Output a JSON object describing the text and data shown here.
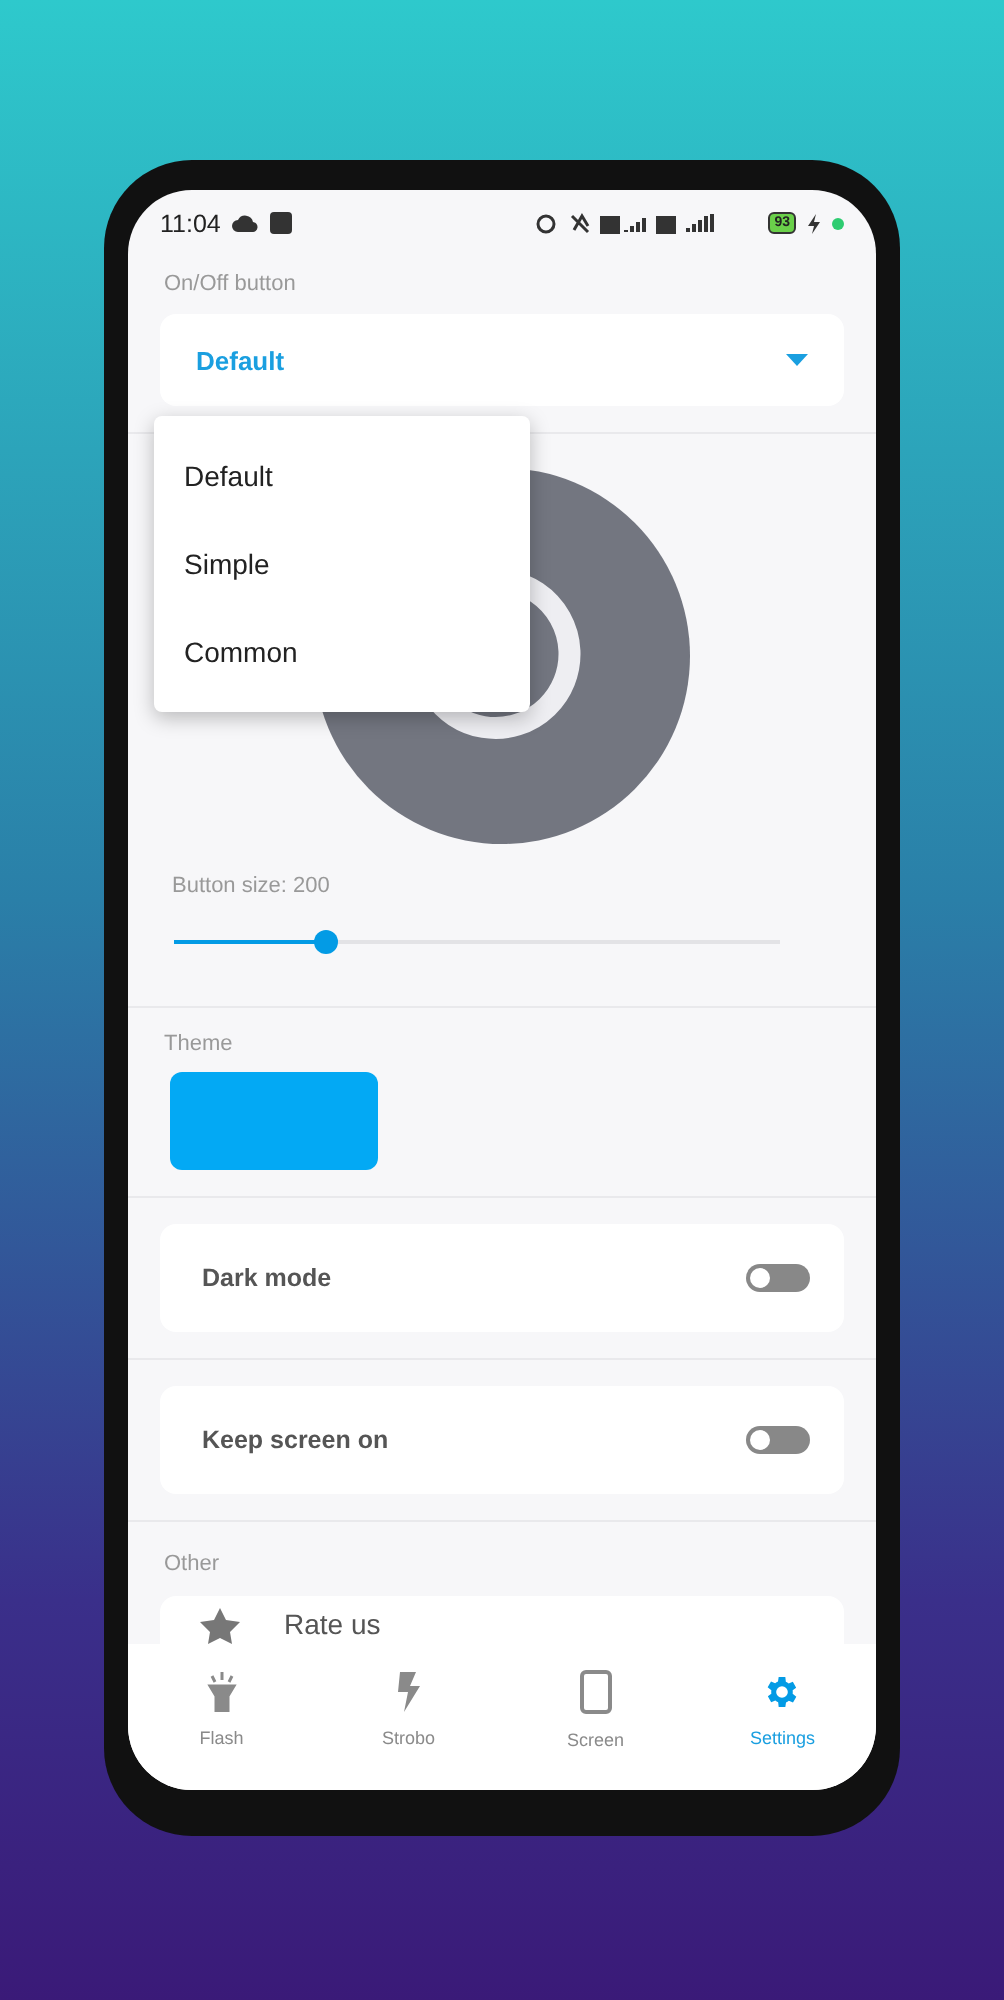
{
  "status_bar": {
    "time": "11:04",
    "battery": "93"
  },
  "on_off_button": {
    "label": "On/Off button",
    "value": "Default"
  },
  "dropdown_menu": [
    {
      "label": "Default"
    },
    {
      "label": "Simple"
    },
    {
      "label": "Common"
    }
  ],
  "button_size": {
    "label": "Button size: 200",
    "level": 0.25
  },
  "theme": {
    "label": "Theme",
    "color": "#03a9f4"
  },
  "switches": [
    {
      "label": "Dark mode",
      "on": false
    },
    {
      "label": "Keep screen on",
      "on": false
    }
  ],
  "other": {
    "label": "Other",
    "items": [
      {
        "label": "Rate us"
      }
    ]
  },
  "nav": [
    {
      "label": "Flash",
      "selected": false
    },
    {
      "label": "Strobo",
      "selected": false
    },
    {
      "label": "Screen",
      "selected": false
    },
    {
      "label": "Settings",
      "selected": true
    }
  ]
}
